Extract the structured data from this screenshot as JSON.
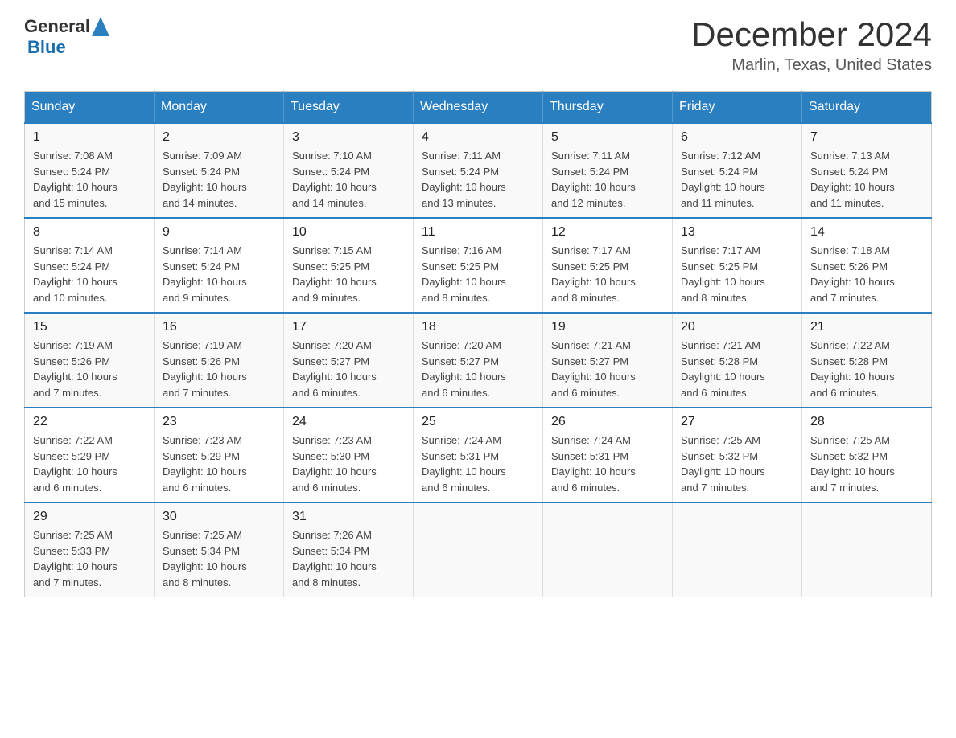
{
  "header": {
    "logo": {
      "text1": "General",
      "text2": "Blue"
    },
    "title": "December 2024",
    "subtitle": "Marlin, Texas, United States"
  },
  "days_of_week": [
    "Sunday",
    "Monday",
    "Tuesday",
    "Wednesday",
    "Thursday",
    "Friday",
    "Saturday"
  ],
  "weeks": [
    [
      {
        "day": "1",
        "sunrise": "7:08 AM",
        "sunset": "5:24 PM",
        "daylight": "10 hours and 15 minutes."
      },
      {
        "day": "2",
        "sunrise": "7:09 AM",
        "sunset": "5:24 PM",
        "daylight": "10 hours and 14 minutes."
      },
      {
        "day": "3",
        "sunrise": "7:10 AM",
        "sunset": "5:24 PM",
        "daylight": "10 hours and 14 minutes."
      },
      {
        "day": "4",
        "sunrise": "7:11 AM",
        "sunset": "5:24 PM",
        "daylight": "10 hours and 13 minutes."
      },
      {
        "day": "5",
        "sunrise": "7:11 AM",
        "sunset": "5:24 PM",
        "daylight": "10 hours and 12 minutes."
      },
      {
        "day": "6",
        "sunrise": "7:12 AM",
        "sunset": "5:24 PM",
        "daylight": "10 hours and 11 minutes."
      },
      {
        "day": "7",
        "sunrise": "7:13 AM",
        "sunset": "5:24 PM",
        "daylight": "10 hours and 11 minutes."
      }
    ],
    [
      {
        "day": "8",
        "sunrise": "7:14 AM",
        "sunset": "5:24 PM",
        "daylight": "10 hours and 10 minutes."
      },
      {
        "day": "9",
        "sunrise": "7:14 AM",
        "sunset": "5:24 PM",
        "daylight": "10 hours and 9 minutes."
      },
      {
        "day": "10",
        "sunrise": "7:15 AM",
        "sunset": "5:25 PM",
        "daylight": "10 hours and 9 minutes."
      },
      {
        "day": "11",
        "sunrise": "7:16 AM",
        "sunset": "5:25 PM",
        "daylight": "10 hours and 8 minutes."
      },
      {
        "day": "12",
        "sunrise": "7:17 AM",
        "sunset": "5:25 PM",
        "daylight": "10 hours and 8 minutes."
      },
      {
        "day": "13",
        "sunrise": "7:17 AM",
        "sunset": "5:25 PM",
        "daylight": "10 hours and 8 minutes."
      },
      {
        "day": "14",
        "sunrise": "7:18 AM",
        "sunset": "5:26 PM",
        "daylight": "10 hours and 7 minutes."
      }
    ],
    [
      {
        "day": "15",
        "sunrise": "7:19 AM",
        "sunset": "5:26 PM",
        "daylight": "10 hours and 7 minutes."
      },
      {
        "day": "16",
        "sunrise": "7:19 AM",
        "sunset": "5:26 PM",
        "daylight": "10 hours and 7 minutes."
      },
      {
        "day": "17",
        "sunrise": "7:20 AM",
        "sunset": "5:27 PM",
        "daylight": "10 hours and 6 minutes."
      },
      {
        "day": "18",
        "sunrise": "7:20 AM",
        "sunset": "5:27 PM",
        "daylight": "10 hours and 6 minutes."
      },
      {
        "day": "19",
        "sunrise": "7:21 AM",
        "sunset": "5:27 PM",
        "daylight": "10 hours and 6 minutes."
      },
      {
        "day": "20",
        "sunrise": "7:21 AM",
        "sunset": "5:28 PM",
        "daylight": "10 hours and 6 minutes."
      },
      {
        "day": "21",
        "sunrise": "7:22 AM",
        "sunset": "5:28 PM",
        "daylight": "10 hours and 6 minutes."
      }
    ],
    [
      {
        "day": "22",
        "sunrise": "7:22 AM",
        "sunset": "5:29 PM",
        "daylight": "10 hours and 6 minutes."
      },
      {
        "day": "23",
        "sunrise": "7:23 AM",
        "sunset": "5:29 PM",
        "daylight": "10 hours and 6 minutes."
      },
      {
        "day": "24",
        "sunrise": "7:23 AM",
        "sunset": "5:30 PM",
        "daylight": "10 hours and 6 minutes."
      },
      {
        "day": "25",
        "sunrise": "7:24 AM",
        "sunset": "5:31 PM",
        "daylight": "10 hours and 6 minutes."
      },
      {
        "day": "26",
        "sunrise": "7:24 AM",
        "sunset": "5:31 PM",
        "daylight": "10 hours and 6 minutes."
      },
      {
        "day": "27",
        "sunrise": "7:25 AM",
        "sunset": "5:32 PM",
        "daylight": "10 hours and 7 minutes."
      },
      {
        "day": "28",
        "sunrise": "7:25 AM",
        "sunset": "5:32 PM",
        "daylight": "10 hours and 7 minutes."
      }
    ],
    [
      {
        "day": "29",
        "sunrise": "7:25 AM",
        "sunset": "5:33 PM",
        "daylight": "10 hours and 7 minutes."
      },
      {
        "day": "30",
        "sunrise": "7:25 AM",
        "sunset": "5:34 PM",
        "daylight": "10 hours and 8 minutes."
      },
      {
        "day": "31",
        "sunrise": "7:26 AM",
        "sunset": "5:34 PM",
        "daylight": "10 hours and 8 minutes."
      },
      null,
      null,
      null,
      null
    ]
  ],
  "labels": {
    "sunrise": "Sunrise:",
    "sunset": "Sunset:",
    "daylight": "Daylight:"
  }
}
